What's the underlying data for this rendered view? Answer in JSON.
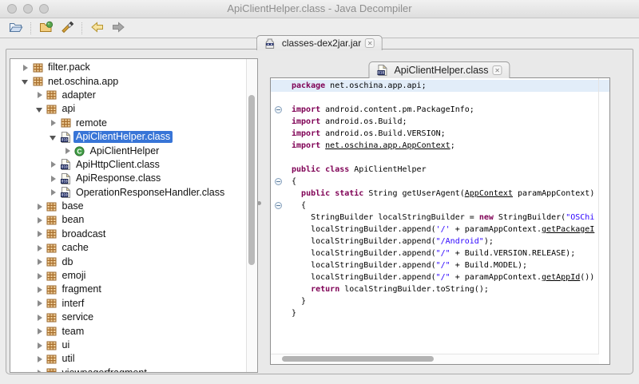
{
  "window": {
    "title": "ApiClientHelper.class - Java Decompiler"
  },
  "toolbar": {
    "groups": [
      [
        {
          "name": "open-file-button",
          "icon": "open-folder-icon"
        }
      ],
      [
        {
          "name": "open-type-button",
          "icon": "open-jar-icon"
        },
        {
          "name": "search-button",
          "icon": "paintbrush-icon"
        }
      ],
      [
        {
          "name": "back-button",
          "icon": "back-arrow-icon"
        },
        {
          "name": "forward-button",
          "icon": "forward-arrow-icon"
        }
      ]
    ]
  },
  "workspace_tab": {
    "label": "classes-dex2jar.jar",
    "icon": "jar-icon",
    "close_icon": "close-icon"
  },
  "tree": {
    "items": [
      {
        "label": "filter.pack",
        "depth": 0,
        "arrow": "collapsed",
        "icon": "package-icon"
      },
      {
        "label": "net.oschina.app",
        "depth": 0,
        "arrow": "expanded",
        "icon": "package-icon"
      },
      {
        "label": "adapter",
        "depth": 1,
        "arrow": "collapsed",
        "icon": "package-icon"
      },
      {
        "label": "api",
        "depth": 1,
        "arrow": "expanded",
        "icon": "package-icon"
      },
      {
        "label": "remote",
        "depth": 2,
        "arrow": "collapsed",
        "icon": "package-icon"
      },
      {
        "label": "ApiClientHelper.class",
        "depth": 2,
        "arrow": "expanded",
        "icon": "classfile-icon",
        "selected": true
      },
      {
        "label": "ApiClientHelper",
        "depth": 3,
        "arrow": "collapsed",
        "icon": "class-icon"
      },
      {
        "label": "ApiHttpClient.class",
        "depth": 2,
        "arrow": "collapsed",
        "icon": "classfile-icon"
      },
      {
        "label": "ApiResponse.class",
        "depth": 2,
        "arrow": "collapsed",
        "icon": "classfile-icon"
      },
      {
        "label": "OperationResponseHandler.class",
        "depth": 2,
        "arrow": "collapsed",
        "icon": "classfile-icon"
      },
      {
        "label": "base",
        "depth": 1,
        "arrow": "collapsed",
        "icon": "package-icon"
      },
      {
        "label": "bean",
        "depth": 1,
        "arrow": "collapsed",
        "icon": "package-icon"
      },
      {
        "label": "broadcast",
        "depth": 1,
        "arrow": "collapsed",
        "icon": "package-icon"
      },
      {
        "label": "cache",
        "depth": 1,
        "arrow": "collapsed",
        "icon": "package-icon"
      },
      {
        "label": "db",
        "depth": 1,
        "arrow": "collapsed",
        "icon": "package-icon"
      },
      {
        "label": "emoji",
        "depth": 1,
        "arrow": "collapsed",
        "icon": "package-icon"
      },
      {
        "label": "fragment",
        "depth": 1,
        "arrow": "collapsed",
        "icon": "package-icon"
      },
      {
        "label": "interf",
        "depth": 1,
        "arrow": "collapsed",
        "icon": "package-icon"
      },
      {
        "label": "service",
        "depth": 1,
        "arrow": "collapsed",
        "icon": "package-icon"
      },
      {
        "label": "team",
        "depth": 1,
        "arrow": "collapsed",
        "icon": "package-icon"
      },
      {
        "label": "ui",
        "depth": 1,
        "arrow": "collapsed",
        "icon": "package-icon"
      },
      {
        "label": "util",
        "depth": 1,
        "arrow": "collapsed",
        "icon": "package-icon"
      },
      {
        "label": "viewpagerfragment",
        "depth": 1,
        "arrow": "collapsed",
        "icon": "package-icon"
      }
    ]
  },
  "editor": {
    "tab": {
      "label": "ApiClientHelper.class",
      "icon": "classfile-icon",
      "close_icon": "close-icon"
    },
    "code": {
      "lines": [
        {
          "highlight": true,
          "seg": [
            {
              "t": "k",
              "x": "package"
            },
            {
              "t": "p",
              "x": " net.oschina.app.api;"
            }
          ]
        },
        {
          "seg": []
        },
        {
          "fold": true,
          "seg": [
            {
              "t": "k",
              "x": "import"
            },
            {
              "t": "p",
              "x": " android.content.pm.PackageInfo;"
            }
          ]
        },
        {
          "seg": [
            {
              "t": "k",
              "x": "import"
            },
            {
              "t": "p",
              "x": " android.os.Build;"
            }
          ]
        },
        {
          "seg": [
            {
              "t": "k",
              "x": "import"
            },
            {
              "t": "p",
              "x": " android.os.Build.VERSION;"
            }
          ]
        },
        {
          "seg": [
            {
              "t": "k",
              "x": "import"
            },
            {
              "t": "p",
              "x": " "
            },
            {
              "t": "l",
              "x": "net.oschina.app.AppContext"
            },
            {
              "t": "p",
              "x": ";"
            }
          ]
        },
        {
          "seg": []
        },
        {
          "seg": [
            {
              "t": "k",
              "x": "public"
            },
            {
              "t": "p",
              "x": " "
            },
            {
              "t": "k",
              "x": "class"
            },
            {
              "t": "p",
              "x": " ApiClientHelper"
            }
          ]
        },
        {
          "fold": true,
          "seg": [
            {
              "t": "p",
              "x": "{"
            }
          ]
        },
        {
          "seg": [
            {
              "t": "p",
              "x": "  "
            },
            {
              "t": "k",
              "x": "public"
            },
            {
              "t": "p",
              "x": " "
            },
            {
              "t": "k",
              "x": "static"
            },
            {
              "t": "p",
              "x": " String getUserAgent("
            },
            {
              "t": "l",
              "x": "AppContext"
            },
            {
              "t": "p",
              "x": " paramAppContext)"
            }
          ]
        },
        {
          "fold": true,
          "seg": [
            {
              "t": "p",
              "x": "  {"
            }
          ]
        },
        {
          "seg": [
            {
              "t": "p",
              "x": "    StringBuilder localStringBuilder = "
            },
            {
              "t": "k",
              "x": "new"
            },
            {
              "t": "p",
              "x": " StringBuilder("
            },
            {
              "t": "s",
              "x": "\"OSChi"
            }
          ]
        },
        {
          "seg": [
            {
              "t": "p",
              "x": "    localStringBuilder.append("
            },
            {
              "t": "s",
              "x": "'/'"
            },
            {
              "t": "p",
              "x": " + paramAppContext."
            },
            {
              "t": "l",
              "x": "getPackageI"
            }
          ]
        },
        {
          "seg": [
            {
              "t": "p",
              "x": "    localStringBuilder.append("
            },
            {
              "t": "s",
              "x": "\"/Android\""
            },
            {
              "t": "p",
              "x": ");"
            }
          ]
        },
        {
          "seg": [
            {
              "t": "p",
              "x": "    localStringBuilder.append("
            },
            {
              "t": "s",
              "x": "\"/\""
            },
            {
              "t": "p",
              "x": " + Build.VERSION.RELEASE);"
            }
          ]
        },
        {
          "seg": [
            {
              "t": "p",
              "x": "    localStringBuilder.append("
            },
            {
              "t": "s",
              "x": "\"/\""
            },
            {
              "t": "p",
              "x": " + Build.MODEL);"
            }
          ]
        },
        {
          "seg": [
            {
              "t": "p",
              "x": "    localStringBuilder.append("
            },
            {
              "t": "s",
              "x": "\"/\""
            },
            {
              "t": "p",
              "x": " + paramAppContext."
            },
            {
              "t": "l",
              "x": "getAppId"
            },
            {
              "t": "p",
              "x": "())"
            }
          ]
        },
        {
          "seg": [
            {
              "t": "p",
              "x": "    "
            },
            {
              "t": "k",
              "x": "return"
            },
            {
              "t": "p",
              "x": " localStringBuilder.toString();"
            }
          ]
        },
        {
          "seg": [
            {
              "t": "p",
              "x": "  }"
            }
          ]
        },
        {
          "seg": [
            {
              "t": "p",
              "x": "}"
            }
          ]
        }
      ]
    }
  },
  "colors": {
    "selection": "#3875d7",
    "keyword": "#7f0055",
    "string": "#2a00ff",
    "line_highlight": "#e2edf9",
    "package_icon": "#a9702f",
    "class_icon_green": "#43a047"
  }
}
